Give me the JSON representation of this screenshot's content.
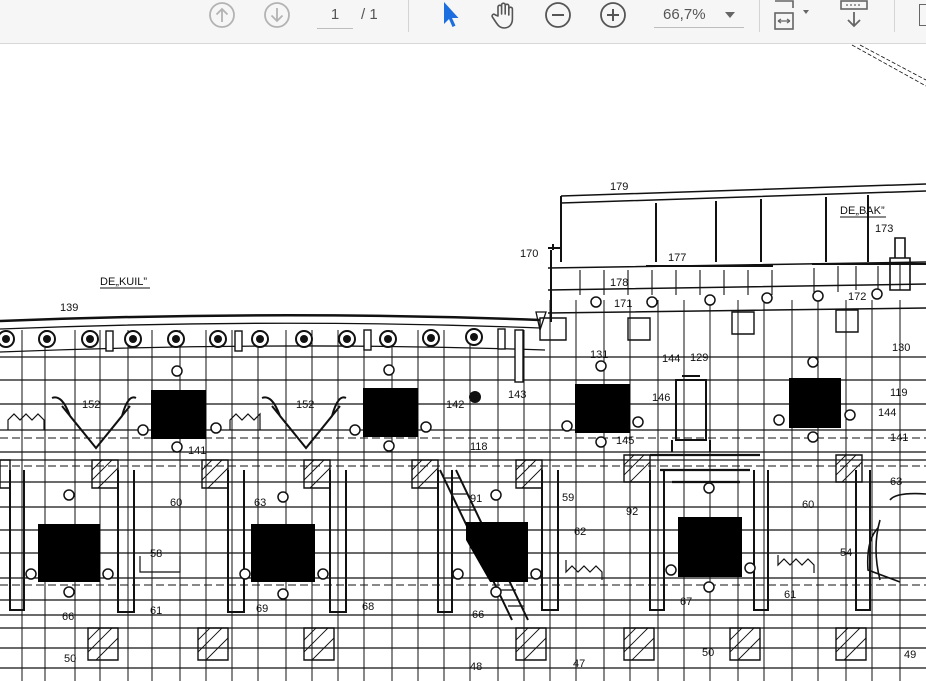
{
  "toolbar": {
    "page_current": "1",
    "page_total": "/ 1",
    "zoom": "66,7%",
    "icons": [
      "prev-page-icon",
      "next-page-icon",
      "select-arrow-icon",
      "hand-tool-icon",
      "zoom-out-icon",
      "zoom-in-icon",
      "zoom-dropdown-icon",
      "fit-page-icon",
      "download-icon"
    ]
  },
  "drawing": {
    "titles": [
      "DE„KUIL”",
      "DE„BAK”"
    ],
    "labels": [
      "179",
      "173",
      "170",
      "177",
      "178",
      "171",
      "172",
      "139",
      "131",
      "144",
      "129",
      "130",
      "152",
      "152",
      "142",
      "143",
      "146",
      "119",
      "144",
      "141",
      "118",
      "145",
      "141",
      "60",
      "63",
      "91",
      "59",
      "92",
      "60",
      "62",
      "63",
      "58",
      "54",
      "61",
      "69",
      "68",
      "66",
      "66",
      "67",
      "61",
      "50",
      "48",
      "47",
      "50",
      "49"
    ]
  },
  "colors": {
    "accent_cursor": "#1d6fe0",
    "icon_gray": "#8a8a8a",
    "icon_dark": "#555555"
  }
}
